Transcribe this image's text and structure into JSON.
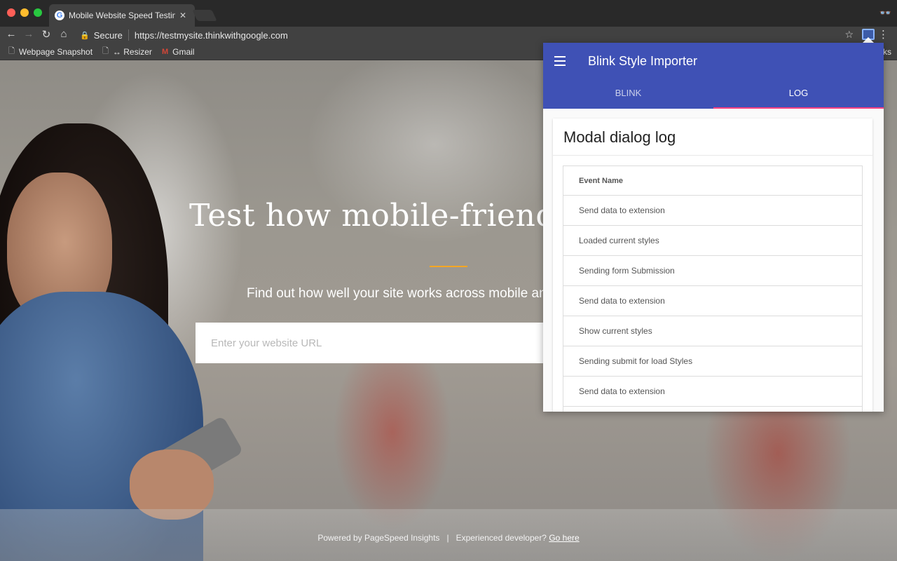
{
  "browser": {
    "tab": {
      "title": "Mobile Website Speed Testing",
      "favicon": "G"
    },
    "address": {
      "security_label": "Secure",
      "url": "https://testmysite.thinkwithgoogle.com"
    },
    "bookmarks": [
      {
        "label": "Webpage Snapshot",
        "icon": "page-icon"
      },
      {
        "label": "↔ Resizer",
        "icon": "page-icon"
      },
      {
        "label": "Gmail",
        "icon": "gmail-icon"
      }
    ],
    "bookmarks_overflow": "ks"
  },
  "page": {
    "headline": "Test how mobile-friendly",
    "subline": "Find out how well your site works across mobile an",
    "url_placeholder": "Enter your website URL",
    "footer": {
      "powered": "Powered by PageSpeed Insights",
      "separator": "|",
      "developer": "Experienced developer?",
      "link": "Go here"
    },
    "accent_color": "#f5a623"
  },
  "popup": {
    "title": "Blink Style Importer",
    "tabs": [
      {
        "label": "BLINK",
        "active": false
      },
      {
        "label": "LOG",
        "active": true
      }
    ],
    "card_title": "Modal dialog log",
    "table": {
      "header": "Event Name",
      "rows": [
        "Send data to extension",
        "Loaded current styles",
        "Sending form Submission",
        "Send data to extension",
        "Show current styles",
        "Sending submit for load Styles",
        "Send data to extension",
        ""
      ]
    },
    "colors": {
      "appbar": "#3f51b5",
      "tab_indicator": "#ff4081"
    }
  }
}
